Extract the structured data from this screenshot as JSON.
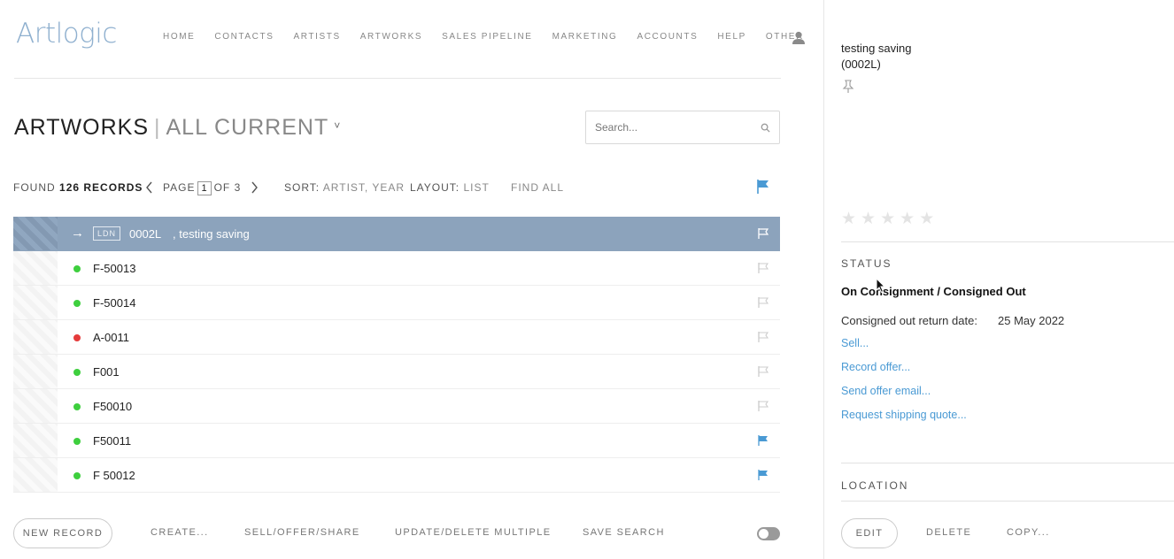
{
  "app": {
    "logo": "Artlogic"
  },
  "nav": {
    "items": [
      "HOME",
      "CONTACTS",
      "ARTISTS",
      "ARTWORKS",
      "SALES PIPELINE",
      "MARKETING",
      "ACCOUNTS",
      "HELP",
      "OTHER"
    ],
    "user_icon": "user-icon"
  },
  "header": {
    "title": "ARTWORKS",
    "separator": "|",
    "view": "ALL CURRENT",
    "view_caret": "˅"
  },
  "search": {
    "placeholder": "Search..."
  },
  "toolbar": {
    "found_label": "FOUND",
    "found_count": "126 RECORDS",
    "page_label": "PAGE",
    "page_current": "1",
    "page_of": "OF 3",
    "sort_label": "SORT:",
    "sort_value": "ARTIST, YEAR",
    "layout_label": "LAYOUT:",
    "layout_value": "LIST",
    "find_all": "FIND ALL"
  },
  "records": {
    "selected": {
      "location": "LDN",
      "code": "0002L",
      "title": ", testing saving"
    },
    "rows": [
      {
        "code": "F-50013",
        "status_color": "#3ecf3e",
        "flagged": false
      },
      {
        "code": "F-50014",
        "status_color": "#3ecf3e",
        "flagged": false
      },
      {
        "code": "A-0011",
        "status_color": "#e53b3b",
        "flagged": false
      },
      {
        "code": "F001",
        "status_color": "#3ecf3e",
        "flagged": false
      },
      {
        "code": "F50010",
        "status_color": "#3ecf3e",
        "flagged": false
      },
      {
        "code": "F50011",
        "status_color": "#3ecf3e",
        "flagged": true
      },
      {
        "code": "F 50012",
        "status_color": "#3ecf3e",
        "flagged": true
      }
    ]
  },
  "actions": {
    "new_record": "NEW RECORD",
    "create": "CREATE...",
    "sell_offer_share": "SELL/OFFER/SHARE",
    "update_delete": "UPDATE/DELETE MULTIPLE",
    "save_search": "SAVE SEARCH"
  },
  "panel": {
    "title_line1": "testing saving",
    "title_line2": "(0002L)",
    "status_heading": "STATUS",
    "status_value": "On Consignment / Consigned Out",
    "return_label": "Consigned out return date:",
    "return_value": "25 May 2022",
    "links": {
      "sell": "Sell...",
      "record_offer": "Record offer...",
      "send_offer_email": "Send offer email...",
      "shipping_quote": "Request shipping quote..."
    },
    "location_heading": "LOCATION",
    "edit": "EDIT",
    "delete": "DELETE",
    "copy": "COPY..."
  },
  "colors": {
    "accent": "#4a9ad4",
    "selected_row": "#8ca3bc",
    "logo": "#8fb0cf",
    "flag_active": "#4a9ad4",
    "flag_inactive": "#cccccc"
  }
}
